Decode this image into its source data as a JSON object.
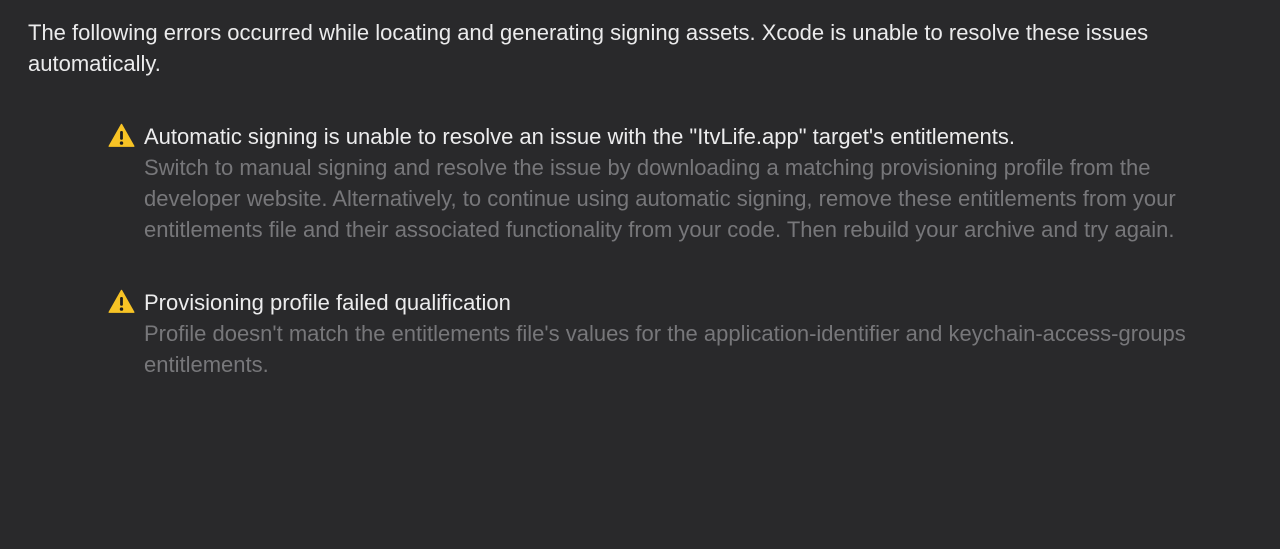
{
  "intro_text": "The following errors occurred while locating and generating signing assets. Xcode is unable to resolve these issues automatically.",
  "issues": [
    {
      "icon": "warning-icon",
      "title": "Automatic signing is unable to resolve an issue with the \"ItvLife.app\" target's entitlements.",
      "detail": "Switch to manual signing and resolve the issue by downloading a matching provisioning profile from the developer website. Alternatively, to continue using automatic signing, remove these entitlements from your entitlements file and their associated functionality from your code. Then rebuild your archive and try again."
    },
    {
      "icon": "warning-icon",
      "title": "Provisioning profile failed qualification",
      "detail": "Profile doesn't match the entitlements file's values for the application-identifier and keychain-access-groups entitlements."
    }
  ],
  "colors": {
    "background": "#29292b",
    "primary_text": "#ebebec",
    "secondary_text": "#77777a",
    "warning_yellow": "#f7c325"
  }
}
